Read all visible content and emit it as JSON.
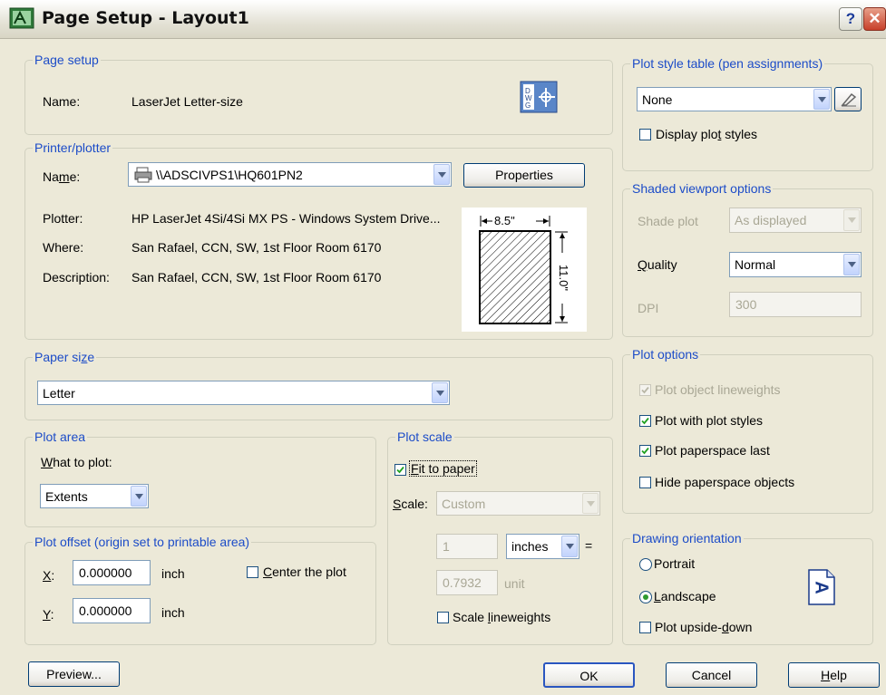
{
  "window": {
    "title": "Page Setup - Layout1",
    "help_glyph": "?",
    "close_glyph": "✕"
  },
  "page_setup": {
    "legend": "Page setup",
    "name_label": "Name:",
    "name_value": "LaserJet Letter-size"
  },
  "printer": {
    "legend": "Printer/plotter",
    "name_label": "Name:",
    "name_value": "\\\\ADSCIVPS1\\HQ601PN2",
    "properties_button": "Properties",
    "plotter_label": "Plotter:",
    "plotter_value": "HP LaserJet 4Si/4Si MX PS - Windows System Drive...",
    "where_label": "Where:",
    "where_value": "San Rafael, CCN, SW, 1st Floor Room 6170",
    "description_label": "Description:",
    "description_value": "San Rafael, CCN, SW, 1st Floor Room 6170",
    "preview_width": "8.5\"",
    "preview_height": "11.0\""
  },
  "paper_size": {
    "legend": "Paper size",
    "value": "Letter"
  },
  "plot_area": {
    "legend": "Plot area",
    "what_label": "What to plot:",
    "what_value": "Extents"
  },
  "plot_offset": {
    "legend": "Plot offset (origin set to printable area)",
    "x_label": "X:",
    "x_value": "0.000000",
    "x_unit": "inch",
    "y_label": "Y:",
    "y_value": "0.000000",
    "y_unit": "inch",
    "center_label": "Center the plot",
    "center_checked": false
  },
  "plot_scale": {
    "legend": "Plot scale",
    "fit_label": "Fit to paper",
    "fit_checked": true,
    "scale_label": "Scale:",
    "scale_value": "Custom",
    "num_value": "1",
    "units_value": "inches",
    "equals": "=",
    "denom_value": "0.7932",
    "denom_unit": "unit",
    "lineweights_label": "Scale lineweights",
    "lineweights_checked": false
  },
  "plot_style_table": {
    "legend": "Plot style table (pen assignments)",
    "value": "None",
    "display_label": "Display plot styles",
    "display_checked": false
  },
  "shaded_viewport": {
    "legend": "Shaded viewport options",
    "shade_label": "Shade plot",
    "shade_value": "As displayed",
    "quality_label": "Quality",
    "quality_value": "Normal",
    "dpi_label": "DPI",
    "dpi_value": "300"
  },
  "plot_options": {
    "legend": "Plot options",
    "items": [
      {
        "label": "Plot object lineweights",
        "checked": true,
        "enabled": false
      },
      {
        "label": "Plot with plot styles",
        "checked": true,
        "enabled": true
      },
      {
        "label": "Plot paperspace last",
        "checked": true,
        "enabled": true
      },
      {
        "label": "Hide paperspace objects",
        "checked": false,
        "enabled": true
      }
    ]
  },
  "orientation": {
    "legend": "Drawing orientation",
    "portrait_label": "Portrait",
    "landscape_label": "Landscape",
    "selected": "landscape",
    "upside_label": "Plot upside-down",
    "upside_checked": false,
    "preview_glyph": "A"
  },
  "footer": {
    "preview_button": "Preview...",
    "ok_button": "OK",
    "cancel_button": "Cancel",
    "help_button": "Help"
  },
  "colors": {
    "legend": "#1c4cc8",
    "dialog": "#ece9d8",
    "disabled_text": "#a9a795",
    "check_mark": "#21a121"
  }
}
